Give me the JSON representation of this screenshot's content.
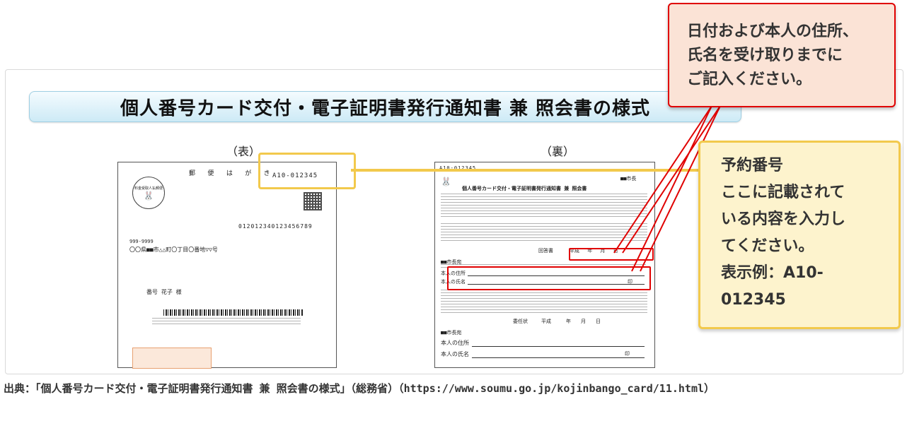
{
  "figure": {
    "title": "個人番号カード交付・電子証明書発行通知書 兼 照会書の様式",
    "front_label": "（表）",
    "back_label": "（裏）",
    "front": {
      "postcard_header": "郵 便 は が き",
      "reservation_number": "A10-012345",
      "stamp_text": "料金受取人払郵便",
      "barcode_number": "012012340123456789",
      "postal_code": "999-9999",
      "address": "〇〇県■■市△△町〇丁目〇番地▽▽号",
      "addressee": "番号 花子 様"
    },
    "back": {
      "reservation_number": "A10-012345",
      "recipient": "■■市長",
      "heading": "個人番号カード交付・電子証明書発行通知書 兼 照会書",
      "reply_label": "回答書",
      "date_fields": "平成　 年　 月　 日",
      "sender": "■■市長宛",
      "address_label": "本人の住所",
      "name_label": "本人の氏名",
      "seal": "印",
      "delegation_label": "委任状",
      "date_fields_2": "平成　　　年　　月　　日",
      "sender_2": "■■市長宛",
      "address_label_2": "本人の住所",
      "name_label_2": "本人の氏名",
      "seal_2": "印"
    }
  },
  "callouts": {
    "red": {
      "lines": [
        "日付および本人の住所、",
        "氏名を受け取りまでに",
        "ご記入ください。"
      ],
      "color": "#e00000",
      "background": "#fbe3d6"
    },
    "yellow": {
      "lines": [
        "予約番号",
        "ここに記載されて",
        "いる内容を入力し",
        "てください。",
        "表示例：A10-",
        "012345"
      ],
      "color": "#f2c94c",
      "background": "#fdf3cd"
    }
  },
  "source": {
    "text": "出典：「個人番号カード交付・電子証明書発行通知書 兼 照会書の様式」（総務省）（https://www.soumu.go.jp/kojinbango_card/11.html）"
  }
}
